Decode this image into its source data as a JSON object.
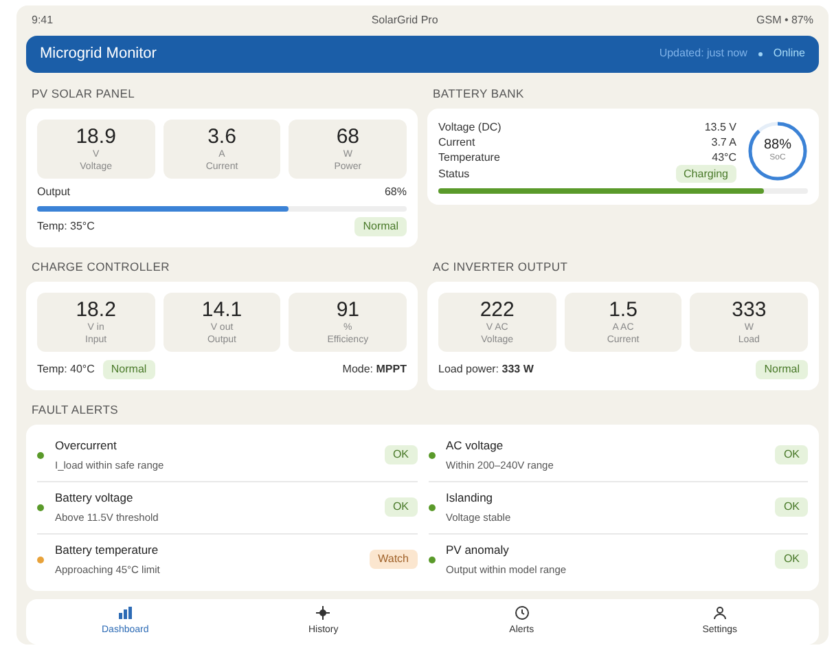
{
  "status_bar": {
    "time": "9:41",
    "app": "SolarGrid Pro",
    "signal": "GSM • 87%"
  },
  "header": {
    "title": "Microgrid Monitor",
    "updated": "Updated: just now",
    "online": "Online"
  },
  "pv": {
    "title": "PV SOLAR PANEL",
    "metrics": [
      {
        "value": "18.9",
        "unit": "V",
        "label": "Voltage"
      },
      {
        "value": "3.6",
        "unit": "A",
        "label": "Current"
      },
      {
        "value": "68",
        "unit": "W",
        "label": "Power"
      }
    ],
    "output_label": "Output",
    "output_reading": "68%",
    "level": 0.68,
    "temp": "Temp: 35°C",
    "badge": {
      "text": "Normal",
      "kind": "ok"
    }
  },
  "battery": {
    "title": "BATTERY BANK",
    "rows": [
      {
        "label": "Voltage (DC)",
        "value": "13.5 V"
      },
      {
        "label": "Current",
        "value": "3.7 A"
      },
      {
        "label": "Temperature",
        "value": "43°C"
      },
      {
        "label": "Status",
        "badge": {
          "text": "Charging",
          "kind": "ok"
        }
      }
    ],
    "soc": {
      "value": "88%",
      "label": "SoC",
      "level": 0.88
    },
    "level": 0.88
  },
  "controller": {
    "title": "CHARGE CONTROLLER",
    "metrics": [
      {
        "value": "18.2",
        "unit": "V in",
        "label": "Input"
      },
      {
        "value": "14.1",
        "unit": "V out",
        "label": "Output"
      },
      {
        "value": "91",
        "unit": "%",
        "label": "Efficiency"
      }
    ],
    "temp": "Temp: 40°C",
    "badge": {
      "text": "Normal",
      "kind": "ok"
    },
    "mode": "Mode: **MPPT**"
  },
  "inverter": {
    "title": "AC INVERTER OUTPUT",
    "metrics": [
      {
        "value": "222",
        "unit": "V AC",
        "label": "Voltage"
      },
      {
        "value": "1.5",
        "unit": "A AC",
        "label": "Current"
      },
      {
        "value": "333",
        "unit": "W",
        "label": "Load"
      }
    ],
    "load": "Load power: **333 W**",
    "badge": {
      "text": "Normal",
      "kind": "ok"
    }
  },
  "faults": {
    "title": "FAULT ALERTS",
    "items": [
      {
        "name": "Overcurrent",
        "detail": "I_load within safe range",
        "badge": "OK",
        "kind": "ok",
        "color": "#5a9a2a"
      },
      {
        "name": "AC voltage",
        "detail": "Within 200–240V range",
        "badge": "OK",
        "kind": "ok",
        "color": "#5a9a2a"
      },
      {
        "name": "Battery voltage",
        "detail": "Above 11.5V threshold",
        "badge": "OK",
        "kind": "ok",
        "color": "#5a9a2a"
      },
      {
        "name": "Islanding",
        "detail": "Voltage stable",
        "badge": "OK",
        "kind": "ok",
        "color": "#5a9a2a"
      },
      {
        "name": "Battery temperature",
        "detail": "Approaching 45°C limit",
        "badge": "Watch",
        "kind": "watch",
        "color": "#e8a23a"
      },
      {
        "name": "PV anomaly",
        "detail": "Output within model range",
        "badge": "OK",
        "kind": "ok",
        "color": "#5a9a2a"
      }
    ]
  },
  "nav": [
    {
      "label": "Dashboard",
      "kind": "chart",
      "selected": true
    },
    {
      "label": "History",
      "kind": "cross",
      "selected": false
    },
    {
      "label": "Alerts",
      "kind": "clock",
      "selected": false
    },
    {
      "label": "Settings",
      "kind": "person",
      "selected": false
    }
  ]
}
